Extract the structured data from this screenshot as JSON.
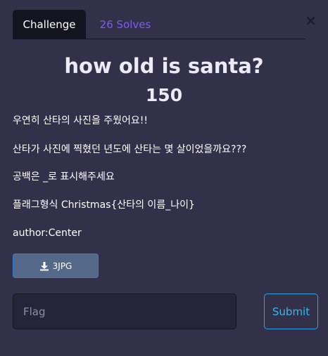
{
  "tabs": {
    "challenge": "Challenge",
    "solves": "26 Solves"
  },
  "close_icon": "×",
  "challenge": {
    "name": "how old is santa?",
    "points": "150",
    "description": [
      "우연히 산타의 사진을 주웠어요!!",
      "산타가 사진에 찍혔던 년도에 산타는 몇 살이었을까요???",
      "공백은 _로 표시해주세요",
      "플래그형식 Christmas{산타의 이름_나이}",
      "author:Center"
    ]
  },
  "file": {
    "label": "3JPG",
    "icon": "download-icon"
  },
  "form": {
    "placeholder": "Flag",
    "value": "",
    "submit_label": "Submit"
  },
  "colors": {
    "background": "#333149",
    "tab_active": "#141320",
    "tab_link": "#7b5cf0",
    "file_button": "#54698a",
    "submit_border": "#2aa4e0"
  }
}
